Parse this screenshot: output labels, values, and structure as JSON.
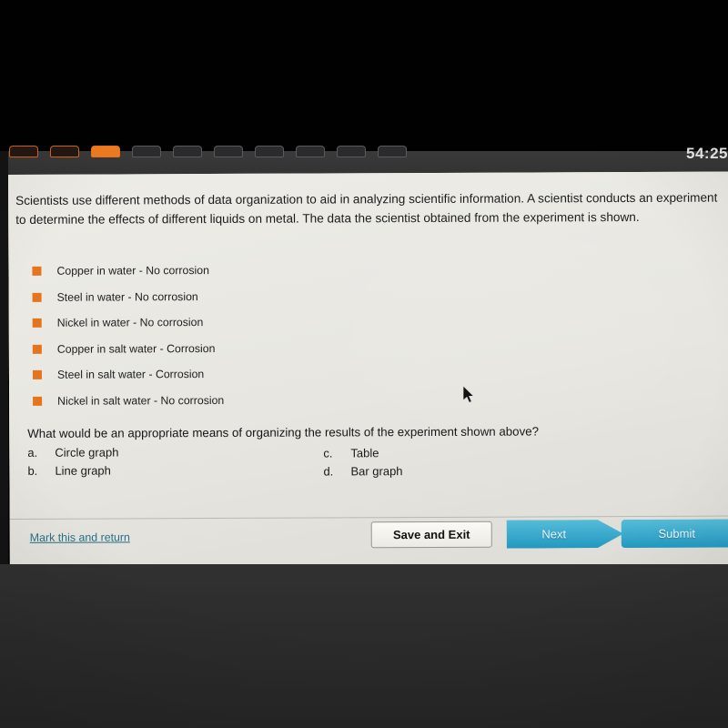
{
  "chrome": {
    "timer": "54:25",
    "steps": [
      {
        "state": "visited"
      },
      {
        "state": "visited"
      },
      {
        "state": "current"
      },
      {
        "state": "upcoming"
      },
      {
        "state": "upcoming"
      },
      {
        "state": "upcoming"
      },
      {
        "state": "upcoming"
      },
      {
        "state": "upcoming"
      },
      {
        "state": "upcoming"
      },
      {
        "state": "upcoming"
      }
    ]
  },
  "question": {
    "stem": "Scientists use different methods of data organization to aid in analyzing scientific information. A scientist conducts an experiment to determine the effects of different liquids on metal. The data the scientist obtained from the experiment is shown.",
    "data_items": [
      "Copper in water - No corrosion",
      "Steel in water - No corrosion",
      "Nickel in water - No corrosion",
      "Copper in salt water - Corrosion",
      "Steel in salt water - Corrosion",
      "Nickel in salt water - No corrosion"
    ],
    "prompt": "What would be an appropriate means of organizing the results of the experiment shown above?",
    "choices": [
      {
        "letter": "a.",
        "text": "Circle graph"
      },
      {
        "letter": "b.",
        "text": "Line graph"
      },
      {
        "letter": "c.",
        "text": "Table"
      },
      {
        "letter": "d.",
        "text": "Bar graph"
      }
    ]
  },
  "footer": {
    "mark_link": "Mark this and return",
    "save_label": "Save and Exit",
    "next_label": "Next",
    "submit_label": "Submit"
  },
  "colors": {
    "bullet_orange": "#e5741f",
    "tab_current_orange": "#ef7b21",
    "button_teal": "#2fa8cc",
    "link_teal": "#2a6f86"
  }
}
